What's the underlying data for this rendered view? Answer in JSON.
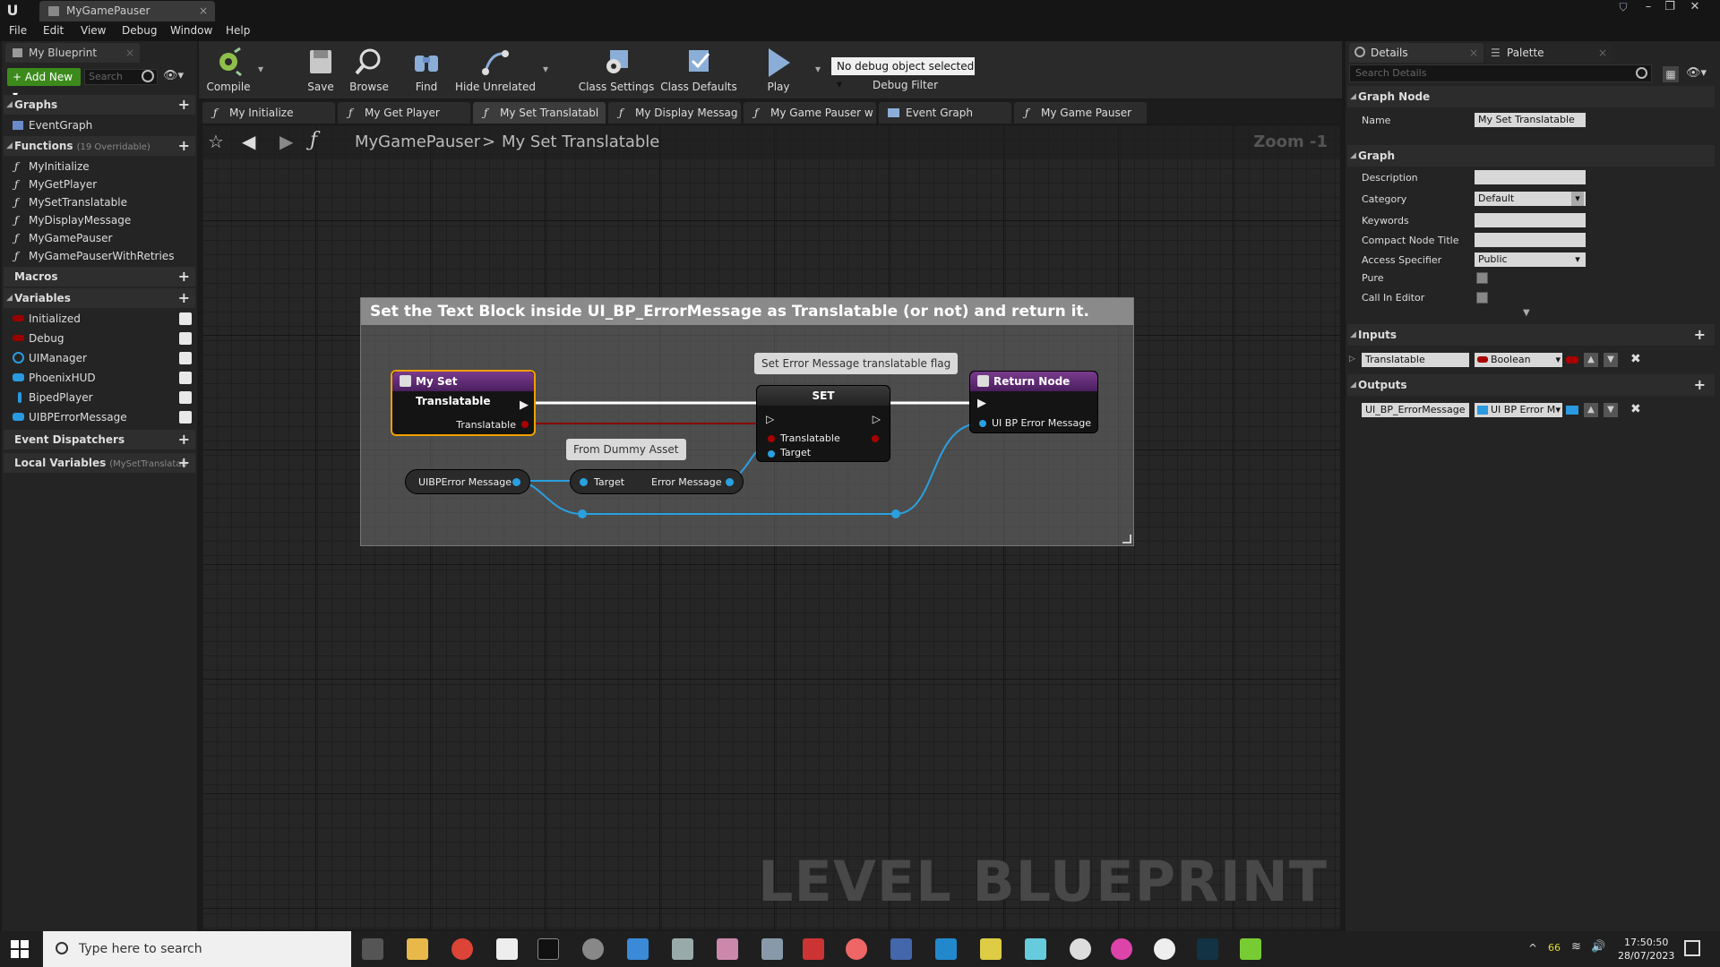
{
  "window": {
    "tab_title": "MyGamePauser",
    "close": "×"
  },
  "menu": [
    "File",
    "Edit",
    "View",
    "Debug",
    "Window",
    "Help"
  ],
  "left": {
    "tab_title": "My Blueprint",
    "add_new": "Add New",
    "search_placeholder": "Search",
    "graphs_label": "Graphs",
    "graphs": [
      "EventGraph"
    ],
    "functions_label": "Functions",
    "functions_count": "(19 Overridable)",
    "functions": [
      "MyInitialize",
      "MyGetPlayer",
      "MySetTranslatable",
      "MyDisplayMessage",
      "MyGamePauser",
      "MyGamePauserWithRetries"
    ],
    "macros_label": "Macros",
    "variables_label": "Variables",
    "variables": [
      {
        "name": "Initialized",
        "color": "#9a0000"
      },
      {
        "name": "Debug",
        "color": "#9a0000"
      },
      {
        "name": "UIManager",
        "color": "#2a9ae0"
      },
      {
        "name": "PhoenixHUD",
        "color": "#2a9ae0"
      },
      {
        "name": "BipedPlayer",
        "color": "#2a9ae0"
      },
      {
        "name": "UIBPErrorMessage",
        "color": "#2a9ae0"
      }
    ],
    "event_dispatchers_label": "Event Dispatchers",
    "local_variables_label": "Local Variables",
    "local_variables_sub": "(MySetTranslatab"
  },
  "toolbar": {
    "compile": "Compile",
    "save": "Save",
    "browse": "Browse",
    "find": "Find",
    "hide_unrelated": "Hide Unrelated",
    "class_settings": "Class Settings",
    "class_defaults": "Class Defaults",
    "play": "Play",
    "debug_select": "No debug object selected",
    "debug_filter": "Debug Filter"
  },
  "doc_tabs": [
    "My Initialize",
    "My Get Player",
    "My Set Translatabl",
    "My Display Messag",
    "My Game Pauser w",
    "Event Graph",
    "My Game Pauser"
  ],
  "breadcrumb": {
    "root": "MyGamePauser",
    "sep": ">",
    "leaf": "My Set Translatable"
  },
  "zoom": "Zoom -1",
  "watermark": "LEVEL BLUEPRINT",
  "graph": {
    "comment": "Set the Text Block inside UI_BP_ErrorMessage as Translatable (or not) and return it.",
    "entry_node": {
      "title": "My Set Translatable",
      "pin": "Translatable"
    },
    "var_node": {
      "pin": "UIBPError Message"
    },
    "getter_node": {
      "in": "Target",
      "out": "Error Message"
    },
    "getter_note": "From Dummy Asset",
    "set_node": {
      "title": "SET",
      "pin1": "Translatable",
      "pin2": "Target"
    },
    "set_note": "Set Error Message translatable flag",
    "return_node": {
      "title": "Return Node",
      "pin": "UI BP Error Message"
    }
  },
  "right": {
    "details_tab": "Details",
    "palette_tab": "Palette",
    "search_placeholder": "Search Details",
    "graph_node_label": "Graph Node",
    "name_label": "Name",
    "name_value": "My Set Translatable",
    "graph_label": "Graph",
    "description_label": "Description",
    "category_label": "Category",
    "category_value": "Default",
    "keywords_label": "Keywords",
    "compact_label": "Compact Node Title",
    "access_label": "Access Specifier",
    "access_value": "Public",
    "pure_label": "Pure",
    "callineditor_label": "Call In Editor",
    "inputs_label": "Inputs",
    "input_name": "Translatable",
    "input_type": "Boolean",
    "outputs_label": "Outputs",
    "output_name": "UI_BP_ErrorMessage",
    "output_type": "UI BP Error M"
  },
  "taskbar": {
    "search_placeholder": "Type here to search",
    "tray_num": "66",
    "time": "17:50:50",
    "date": "28/07/2023"
  }
}
